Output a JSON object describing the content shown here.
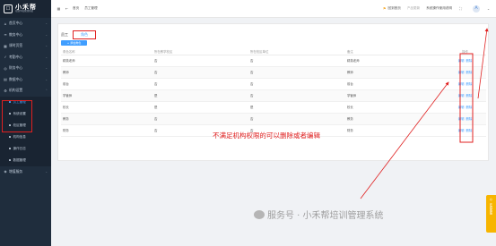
{
  "sidebar": {
    "logo": {
      "title": "小禾帮",
      "sub": "培训学校管理系统"
    },
    "items_top": [
      {
        "label": "首页中心",
        "icon": "home-icon"
      },
      {
        "label": "教务中心",
        "icon": "book-icon"
      },
      {
        "label": "课时页签",
        "icon": "calendar-icon"
      },
      {
        "label": "考勤中心",
        "icon": "check-icon"
      },
      {
        "label": "财务中心",
        "icon": "wallet-icon"
      },
      {
        "label": "数据中心",
        "icon": "chart-icon"
      }
    ],
    "group": {
      "label": "机构设置",
      "icon": "building-icon"
    },
    "sub_items": [
      "员工管理",
      "系统设置",
      "校区管理",
      "机构信息",
      "操作日志",
      "数据管理"
    ],
    "items_bottom": [
      {
        "label": "增值服务",
        "icon": "gift-icon"
      }
    ]
  },
  "topbar": {
    "breadcrumb_home": "首页",
    "breadcrumb_current": "员工管理",
    "right": [
      {
        "label": "回到首页",
        "icon": "flag-icon"
      },
      {
        "label": "产品更新",
        "icon": ""
      },
      {
        "label": "系统操作使用说明",
        "icon": ""
      }
    ],
    "avatar": "A"
  },
  "tabs": [
    "员工",
    "角色"
  ],
  "add_button": "+ 添加角色",
  "table": {
    "headers": [
      "角色名称",
      "所在教学校区",
      "所在校区单位",
      "备注",
      "操作"
    ],
    "rows": [
      [
        "精英老师",
        "否",
        "否",
        "精英老师"
      ],
      [
        "教师",
        "否",
        "否",
        "教师"
      ],
      [
        "前台",
        "否",
        "否",
        "前台"
      ],
      [
        "学管师",
        "是",
        "否",
        "学管师"
      ],
      [
        "校长",
        "是",
        "是",
        "校长"
      ],
      [
        "教务",
        "否",
        "否",
        "教务"
      ],
      [
        "财务",
        "否",
        "否",
        "财务"
      ]
    ],
    "edit_label": "编辑",
    "delete_label": "删除"
  },
  "annotation": "不满足机构权限的可以删除或者编辑",
  "watermark": "服务号 · 小禾帮培训管理系统",
  "side_tab": "在线客服",
  "colors": {
    "accent": "#409eff",
    "sidebar": "#1f2d3d",
    "annotation": "#e02020",
    "side_tab": "#f7b500"
  }
}
